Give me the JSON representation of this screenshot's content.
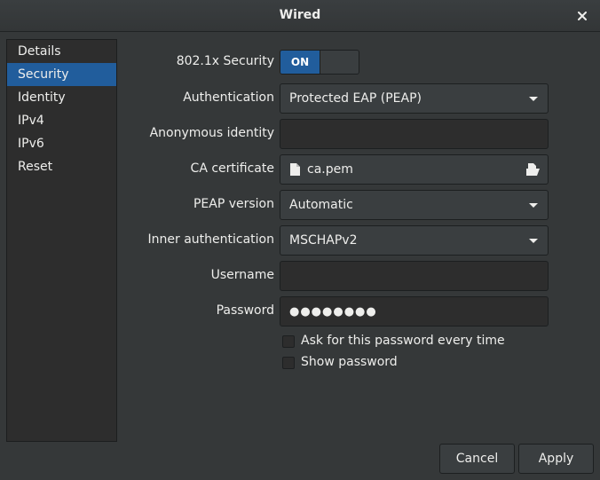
{
  "window": {
    "title": "Wired"
  },
  "sidebar": {
    "items": [
      {
        "label": "Details"
      },
      {
        "label": "Security"
      },
      {
        "label": "Identity"
      },
      {
        "label": "IPv4"
      },
      {
        "label": "IPv6"
      },
      {
        "label": "Reset"
      }
    ],
    "selected": "Security"
  },
  "security": {
    "toggle_label": "802.1x Security",
    "toggle_state": "ON",
    "authentication_label": "Authentication",
    "authentication_value": "Protected EAP (PEAP)",
    "anonymous_identity_label": "Anonymous identity",
    "anonymous_identity_value": "",
    "ca_certificate_label": "CA certificate",
    "ca_certificate_value": "ca.pem",
    "peap_version_label": "PEAP version",
    "peap_version_value": "Automatic",
    "inner_auth_label": "Inner authentication",
    "inner_auth_value": "MSCHAPv2",
    "username_label": "Username",
    "username_value": "",
    "password_label": "Password",
    "password_value": "●●●●●●●●",
    "ask_password_label": "Ask for this password every time",
    "ask_password_checked": false,
    "show_password_label": "Show password",
    "show_password_checked": false
  },
  "buttons": {
    "cancel": "Cancel",
    "apply": "Apply"
  },
  "colors": {
    "accent": "#215d9c",
    "background": "#353839",
    "entry": "#2d2d2d",
    "text": "#eeeeec"
  }
}
